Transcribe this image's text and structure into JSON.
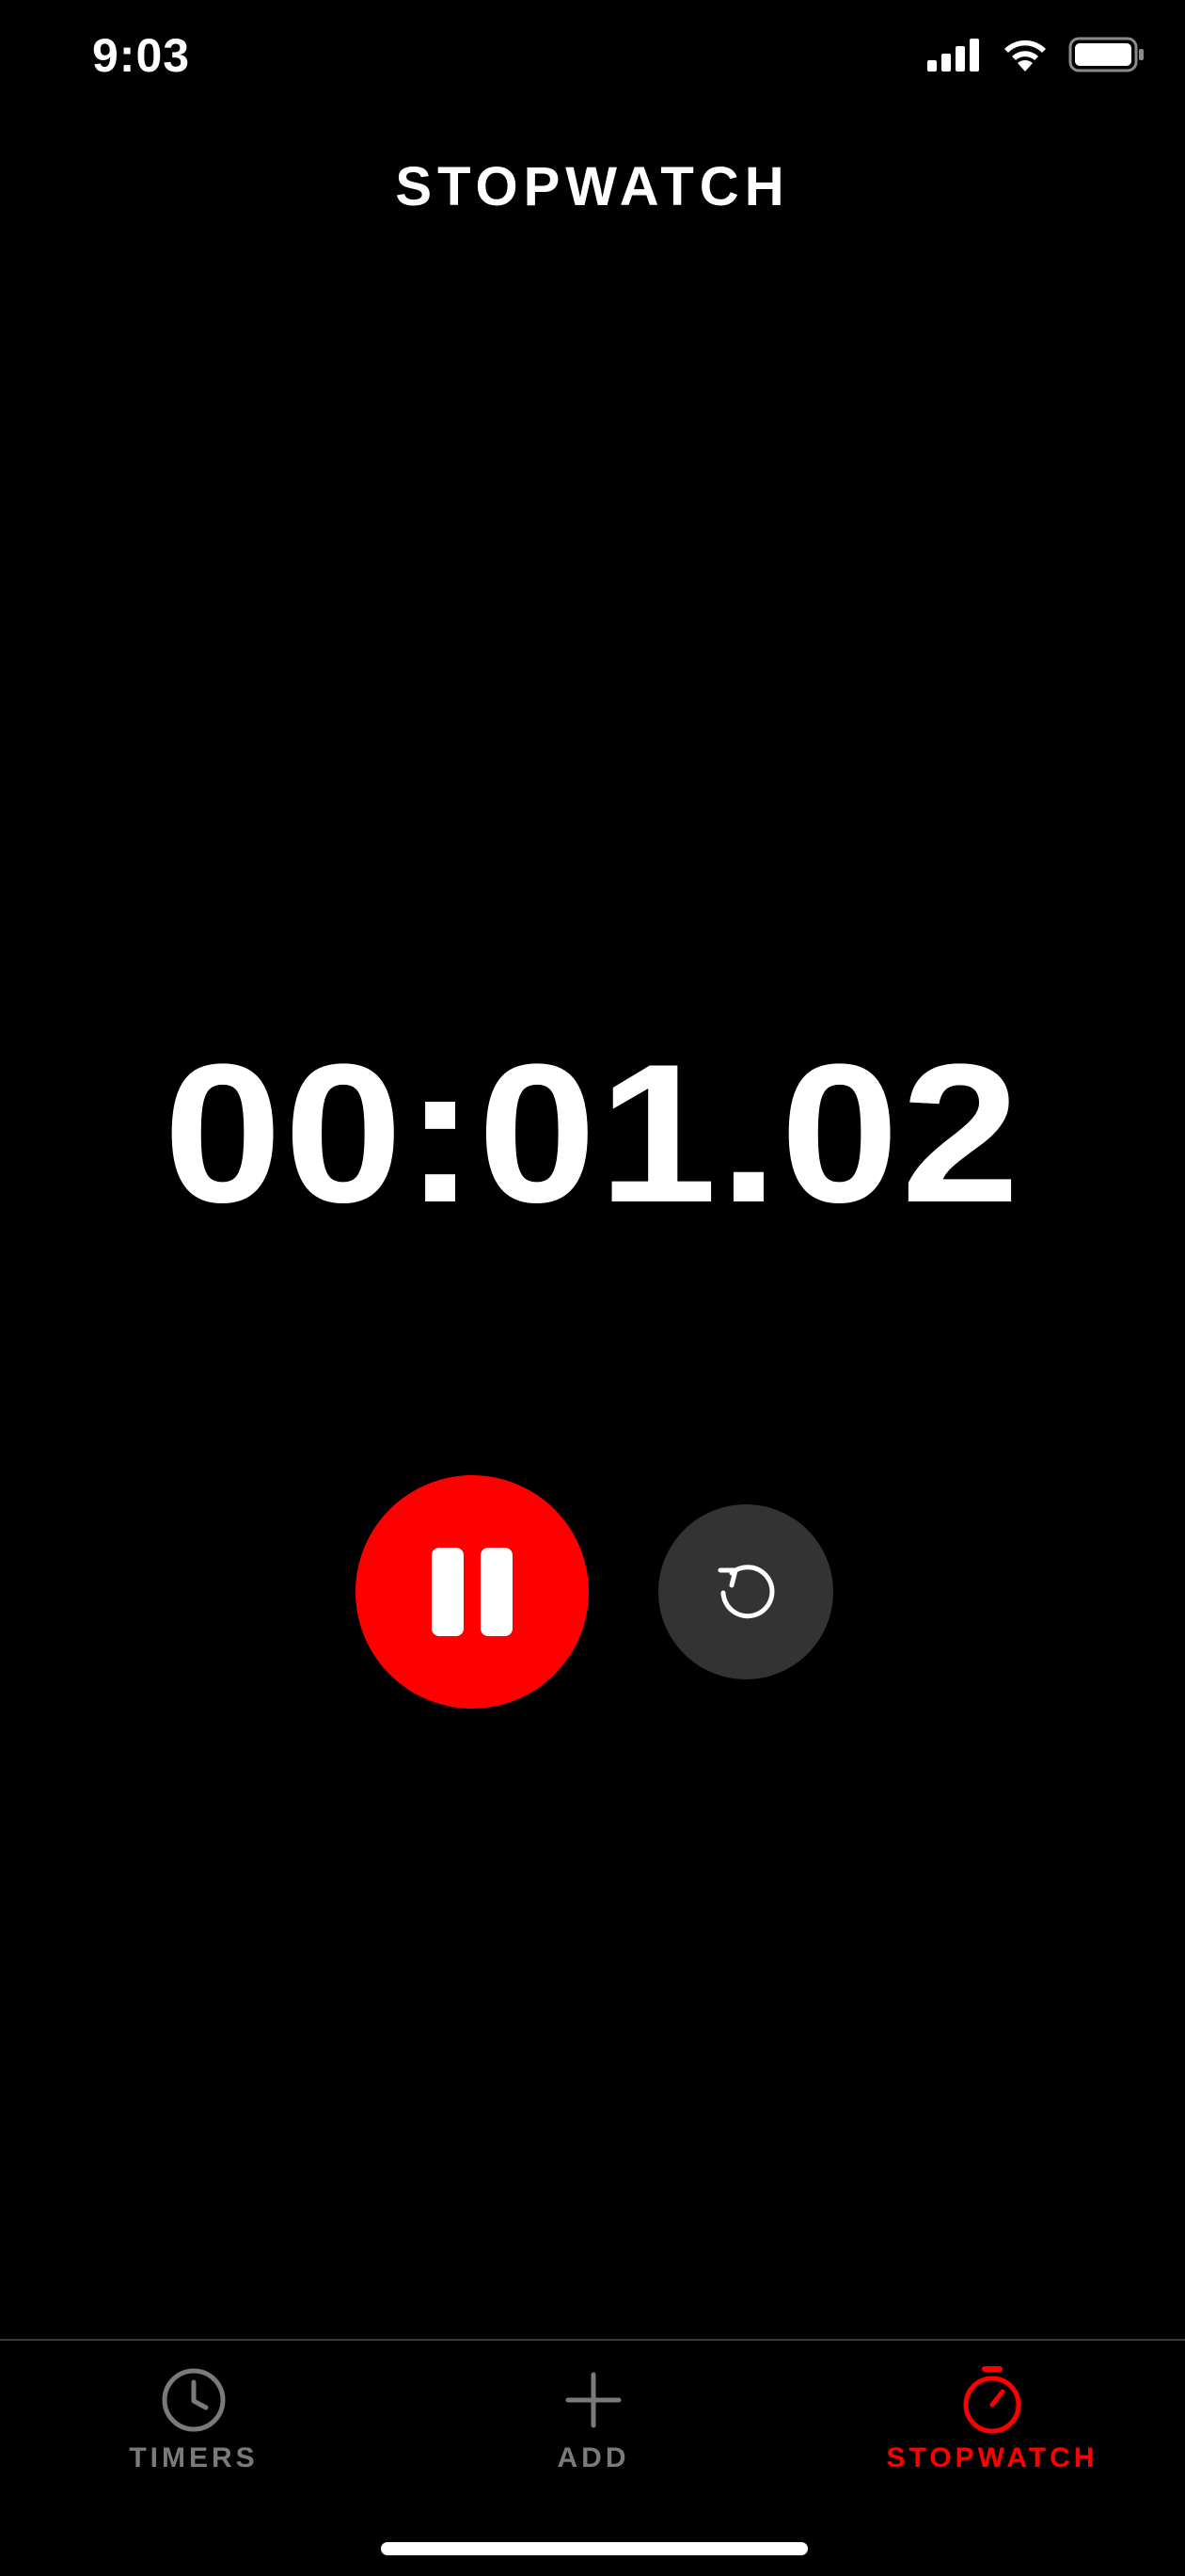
{
  "status_bar": {
    "time": "9:03",
    "icons": [
      "signal-icon",
      "wifi-icon",
      "battery-icon"
    ]
  },
  "header": {
    "title": "STOPWATCH"
  },
  "stopwatch": {
    "elapsed": "00:01.02",
    "pause_icon": "pause-icon",
    "reset_icon": "reset-icon",
    "accent_color": "#ff0000",
    "reset_button_color": "#333333"
  },
  "tab_bar": {
    "tabs": [
      {
        "label": "TIMERS",
        "icon": "clock-icon",
        "active": false
      },
      {
        "label": "ADD",
        "icon": "plus-icon",
        "active": false
      },
      {
        "label": "STOPWATCH",
        "icon": "stopwatch-icon",
        "active": true
      }
    ],
    "active_color": "#ff0000",
    "inactive_color": "#7a7a7a"
  }
}
